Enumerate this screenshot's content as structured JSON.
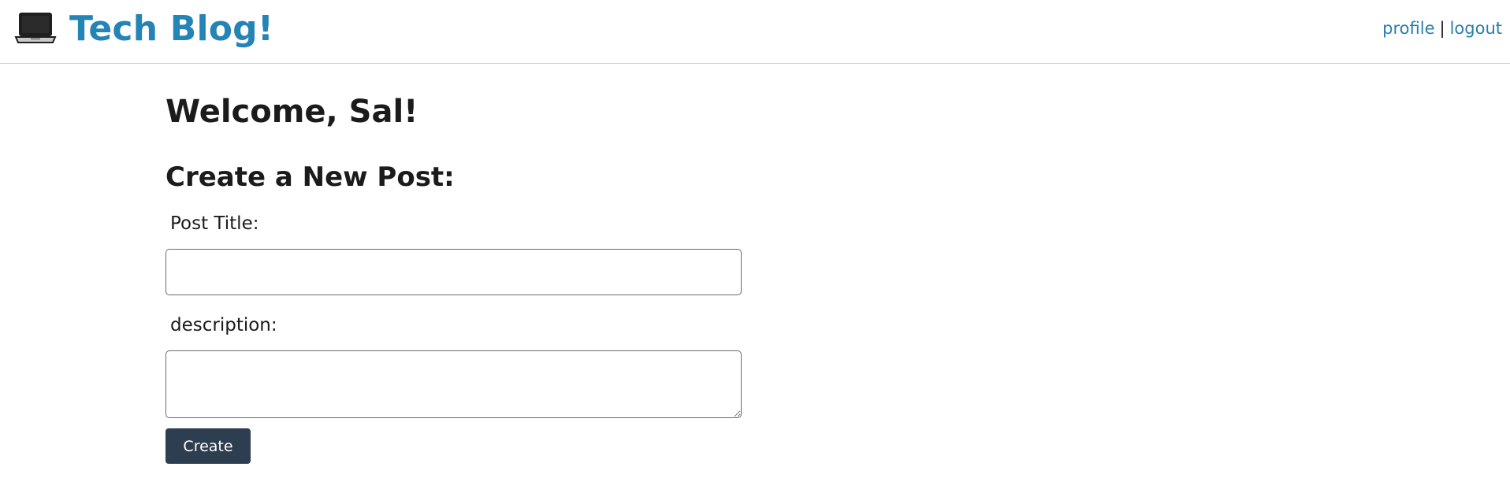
{
  "header": {
    "logo_icon": "laptop-icon",
    "title": "Tech Blog!",
    "nav": {
      "profile_label": "profile",
      "separator": "|",
      "logout_label": "logout"
    }
  },
  "main": {
    "welcome": "Welcome, Sal!",
    "form": {
      "heading": "Create a New Post:",
      "title_label": "Post Title:",
      "title_value": "",
      "description_label": "description:",
      "description_value": "",
      "submit_label": "Create"
    }
  },
  "colors": {
    "brand": "#2384b5",
    "link": "#2a7eab",
    "button": "#2c3e50",
    "border": "#cfcfcf"
  }
}
